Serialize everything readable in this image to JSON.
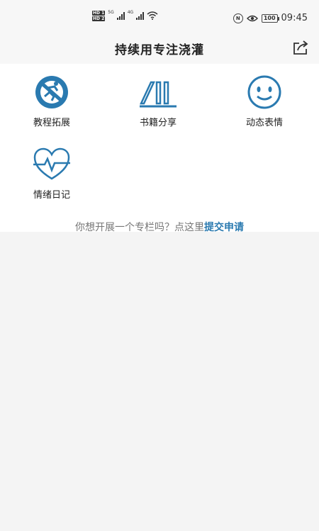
{
  "status_bar": {
    "hd1": "HD 1",
    "hd2": "HD 2",
    "net1": "5G",
    "net2": "4G",
    "battery": "100",
    "time": "09:45"
  },
  "header": {
    "title": "持续用专注浇灌"
  },
  "columns": [
    {
      "label": "教程拓展",
      "icon": "run-icon"
    },
    {
      "label": "书籍分享",
      "icon": "books-icon"
    },
    {
      "label": "动态表情",
      "icon": "smile-icon"
    },
    {
      "label": "情绪日记",
      "icon": "heart-pulse-icon"
    }
  ],
  "footer": {
    "prompt": "你想开展一个专栏吗？点这里",
    "link": "提交申请"
  },
  "colors": {
    "accent": "#2a7ab0",
    "background": "#f4f4f4",
    "panel": "#ffffff"
  }
}
